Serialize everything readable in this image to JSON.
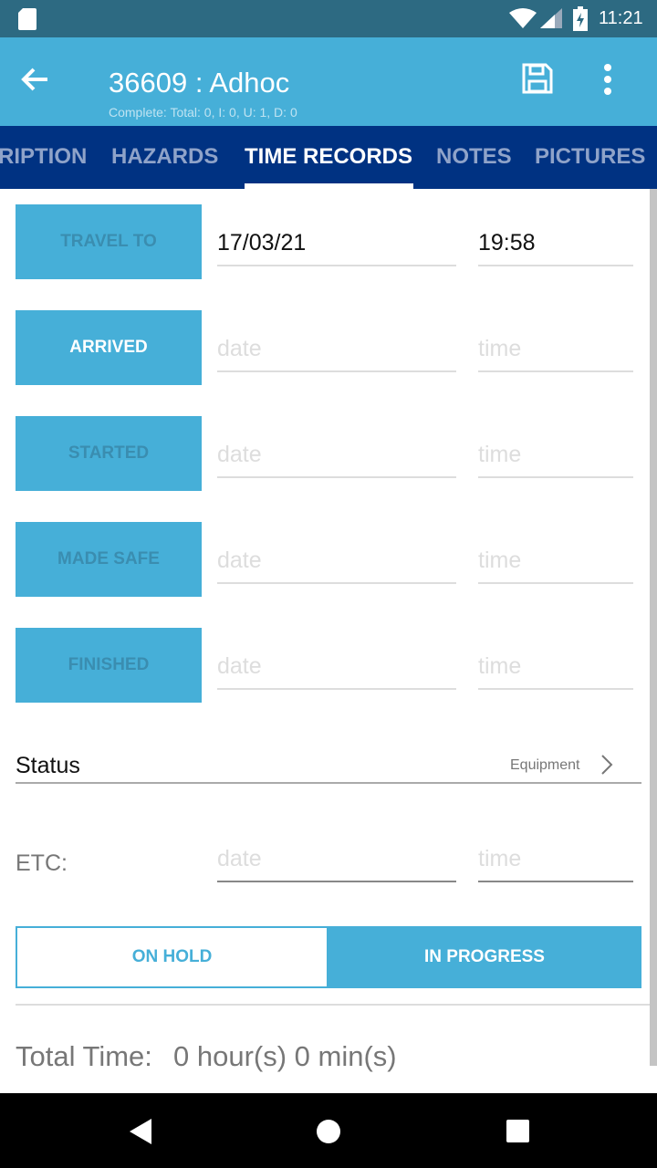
{
  "status_bar": {
    "time": "11:21"
  },
  "toolbar": {
    "title": "36609 : Adhoc",
    "subtitle": "Complete: Total: 0, I: 0, U: 1, D: 0"
  },
  "tabs": [
    {
      "label": "RIPTION"
    },
    {
      "label": "HAZARDS"
    },
    {
      "label": "TIME RECORDS",
      "active": true
    },
    {
      "label": "NOTES"
    },
    {
      "label": "PICTURES"
    }
  ],
  "records": [
    {
      "label": "TRAVEL TO",
      "date": "17/03/21",
      "time": "19:58",
      "enabled": false
    },
    {
      "label": "ARRIVED",
      "date": "",
      "time": "",
      "enabled": true
    },
    {
      "label": "STARTED",
      "date": "",
      "time": "",
      "enabled": false
    },
    {
      "label": "MADE SAFE",
      "date": "",
      "time": "",
      "enabled": false
    },
    {
      "label": "FINISHED",
      "date": "",
      "time": "",
      "enabled": false
    }
  ],
  "placeholders": {
    "date": "date",
    "time": "time"
  },
  "status": {
    "label": "Status",
    "value": "Equipment"
  },
  "etc": {
    "label": "ETC:",
    "date_placeholder": "date",
    "time_placeholder": "time"
  },
  "toggle": {
    "on_hold": "ON HOLD",
    "in_progress": "IN PROGRESS",
    "selected": "IN PROGRESS"
  },
  "total_time": {
    "label": "Total Time:",
    "value": "0 hour(s) 0 min(s)"
  },
  "colors": {
    "primary": "#46afd8",
    "tab_bar": "#003282",
    "status_bar": "#2d6a82"
  }
}
